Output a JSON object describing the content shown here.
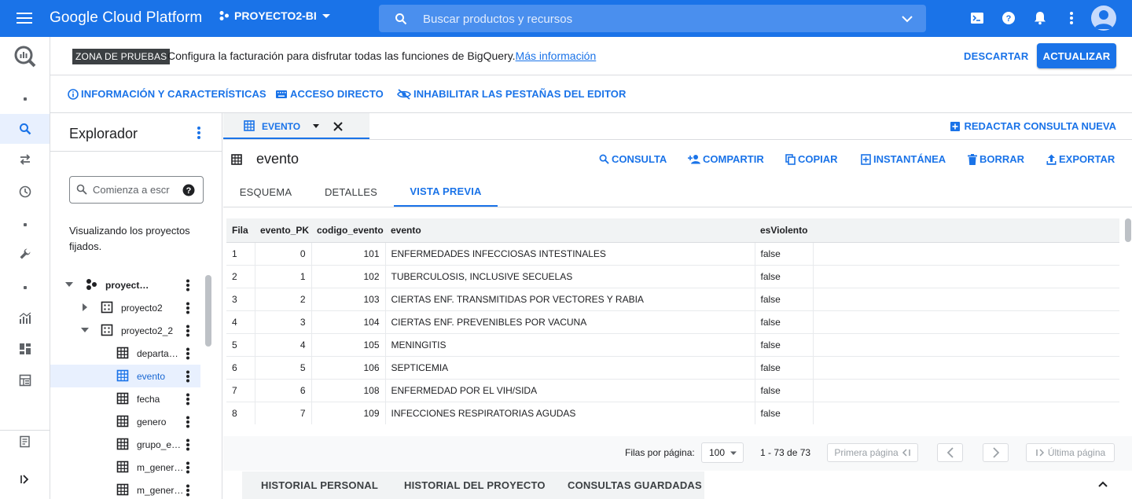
{
  "topbar": {
    "brand": "Google Cloud Platform",
    "project": "PROYECTO2-BI",
    "search_placeholder": "Buscar productos y recursos"
  },
  "banner": {
    "badge": "ZONA DE PRUEBAS",
    "message": "Configura la facturación para disfrutar todas las funciones de BigQuery.",
    "link": "Más información",
    "dismiss": "DESCARTAR",
    "upgrade": "ACTUALIZAR"
  },
  "actions": {
    "info": "INFORMACIÓN Y CARACTERÍSTICAS",
    "shortcut": "ACCESO DIRECTO",
    "disable_tabs": "INHABILITAR LAS PESTAÑAS DEL EDITOR"
  },
  "explorer": {
    "title": "Explorador",
    "search_placeholder": "Comienza a escr",
    "note": "Visualizando los proyectos fijados.",
    "tree": [
      {
        "label": "proyect…",
        "kind": "project",
        "expanded": true
      },
      {
        "label": "proyecto2",
        "kind": "dataset",
        "expanded": false
      },
      {
        "label": "proyecto2_2",
        "kind": "dataset",
        "expanded": true
      },
      {
        "label": "departa…",
        "kind": "table"
      },
      {
        "label": "evento",
        "kind": "table",
        "selected": true
      },
      {
        "label": "fecha",
        "kind": "table"
      },
      {
        "label": "genero",
        "kind": "table"
      },
      {
        "label": "grupo_e…",
        "kind": "table"
      },
      {
        "label": "m_gener…",
        "kind": "table"
      },
      {
        "label": "m_gener…",
        "kind": "table"
      }
    ]
  },
  "editor_tab": {
    "label": "EVENTO",
    "compose": "REDACTAR CONSULTA NUEVA"
  },
  "table": {
    "name": "evento",
    "actions": [
      "CONSULTA",
      "COMPARTIR",
      "COPIAR",
      "INSTANTÁNEA",
      "BORRAR",
      "EXPORTAR"
    ],
    "subtabs": [
      "ESQUEMA",
      "DETALLES",
      "VISTA PREVIA"
    ],
    "active_subtab": "VISTA PREVIA"
  },
  "preview": {
    "columns": [
      "Fila",
      "evento_PK",
      "codigo_evento",
      "evento",
      "esViolento"
    ],
    "rows": [
      [
        "1",
        "0",
        "101",
        "ENFERMEDADES INFECCIOSAS INTESTINALES",
        "false"
      ],
      [
        "2",
        "1",
        "102",
        "TUBERCULOSIS, INCLUSIVE SECUELAS",
        "false"
      ],
      [
        "3",
        "2",
        "103",
        "CIERTAS ENF. TRANSMITIDAS POR VECTORES Y RABIA",
        "false"
      ],
      [
        "4",
        "3",
        "104",
        "CIERTAS ENF. PREVENIBLES POR VACUNA",
        "false"
      ],
      [
        "5",
        "4",
        "105",
        "MENINGITIS",
        "false"
      ],
      [
        "6",
        "5",
        "106",
        "SEPTICEMIA",
        "false"
      ],
      [
        "7",
        "6",
        "108",
        "ENFERMEDAD POR EL VIH/SIDA",
        "false"
      ],
      [
        "8",
        "7",
        "109",
        "INFECCIONES RESPIRATORIAS AGUDAS",
        "false"
      ]
    ]
  },
  "pager": {
    "rows_per_page_label": "Filas por página:",
    "rows_per_page": "100",
    "range": "1 - 73 de 73",
    "first": "Primera página",
    "last": "Última página"
  },
  "bottom_tabs": [
    "HISTORIAL PERSONAL",
    "HISTORIAL DEL PROYECTO",
    "CONSULTAS GUARDADAS"
  ],
  "colors": {
    "primary": "#1a73e8",
    "selected_bg": "#e8f0fe"
  }
}
